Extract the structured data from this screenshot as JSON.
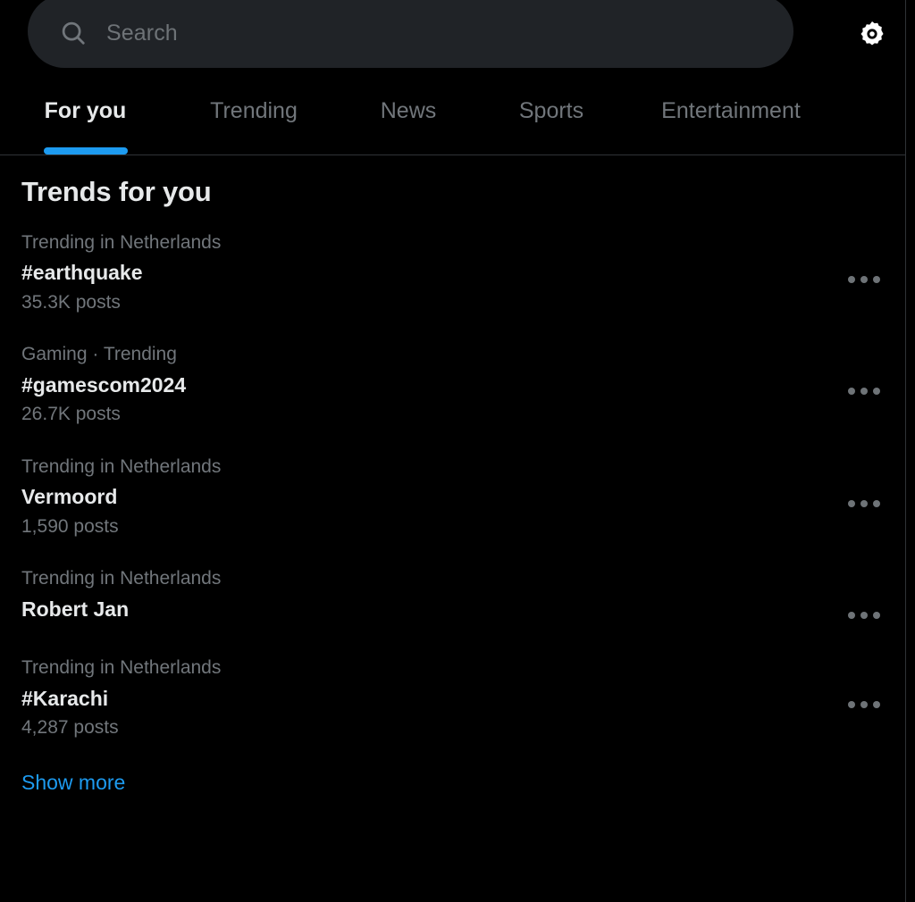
{
  "header": {
    "search": {
      "placeholder": "Search",
      "value": "",
      "icon": "search-icon"
    },
    "settings": {
      "icon": "gear-icon",
      "label": "Settings"
    }
  },
  "tabs": [
    {
      "label": "For you",
      "active": true
    },
    {
      "label": "Trending",
      "active": false
    },
    {
      "label": "News",
      "active": false
    },
    {
      "label": "Sports",
      "active": false
    },
    {
      "label": "Entertainment",
      "active": false
    }
  ],
  "main": {
    "title": "Trends for you",
    "trends": [
      {
        "context": "Trending in Netherlands",
        "name": "#earthquake",
        "count": "35.3K posts",
        "more_icon": "more-horizontal-icon"
      },
      {
        "context": "Gaming · Trending",
        "name": "#gamescom2024",
        "count": "26.7K posts",
        "more_icon": "more-horizontal-icon"
      },
      {
        "context": "Trending in Netherlands",
        "name": "Vermoord",
        "count": "1,590 posts",
        "more_icon": "more-horizontal-icon"
      },
      {
        "context": "Trending in Netherlands",
        "name": "Robert Jan",
        "count": "",
        "more_icon": "more-horizontal-icon"
      },
      {
        "context": "Trending in Netherlands",
        "name": "#Karachi",
        "count": "4,287 posts",
        "more_icon": "more-horizontal-icon"
      }
    ],
    "show_more_label": "Show more"
  },
  "colors": {
    "background": "#000000",
    "search_field": "#202327",
    "accent": "#1d9bf0",
    "text_primary": "#e7e9ea",
    "text_secondary": "#71767b",
    "border": "#2f3336"
  }
}
